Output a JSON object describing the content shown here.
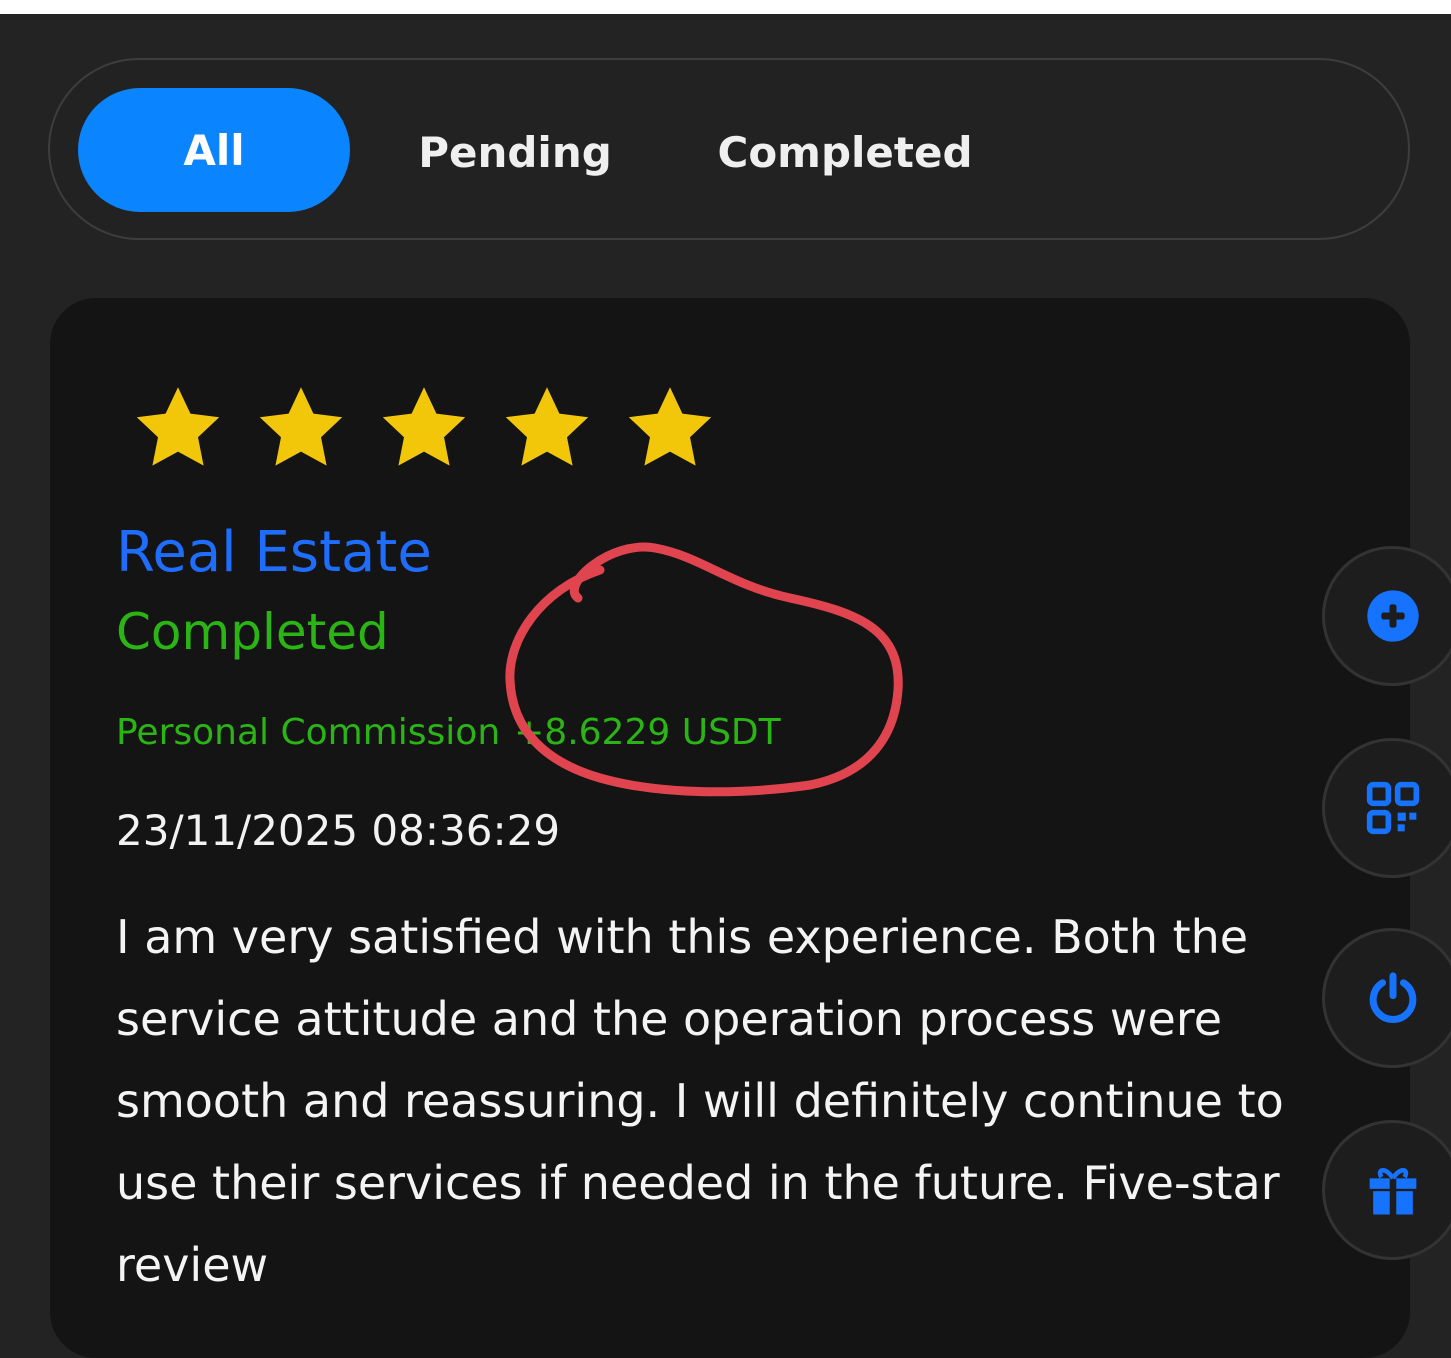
{
  "tabs": [
    {
      "label": "All",
      "active": true
    },
    {
      "label": "Pending",
      "active": false
    },
    {
      "label": "Completed",
      "active": false
    }
  ],
  "record": {
    "rating": 5,
    "rating_max": 5,
    "category": "Real Estate",
    "status": "Completed",
    "commission_label": "Personal Commission",
    "commission_value": "+8.6229 USDT",
    "datetime": "23/11/2025 08:36:29",
    "review": "I am very satisfied with this experience. Both the service attitude and the operation process were smooth and reassuring. I will definitely continue to use their services if needed in the future. Five-star review"
  },
  "side_buttons": [
    {
      "icon": "plus-circle-icon"
    },
    {
      "icon": "qr-code-icon"
    },
    {
      "icon": "power-icon"
    },
    {
      "icon": "gift-icon"
    }
  ],
  "colors": {
    "background": "#232323",
    "card": "#141414",
    "accent_blue": "#0a84ff",
    "category_blue": "#1e6dff",
    "success_green": "#2ab514",
    "star_yellow": "#f2c70a",
    "annotation_red": "#e0454f"
  }
}
